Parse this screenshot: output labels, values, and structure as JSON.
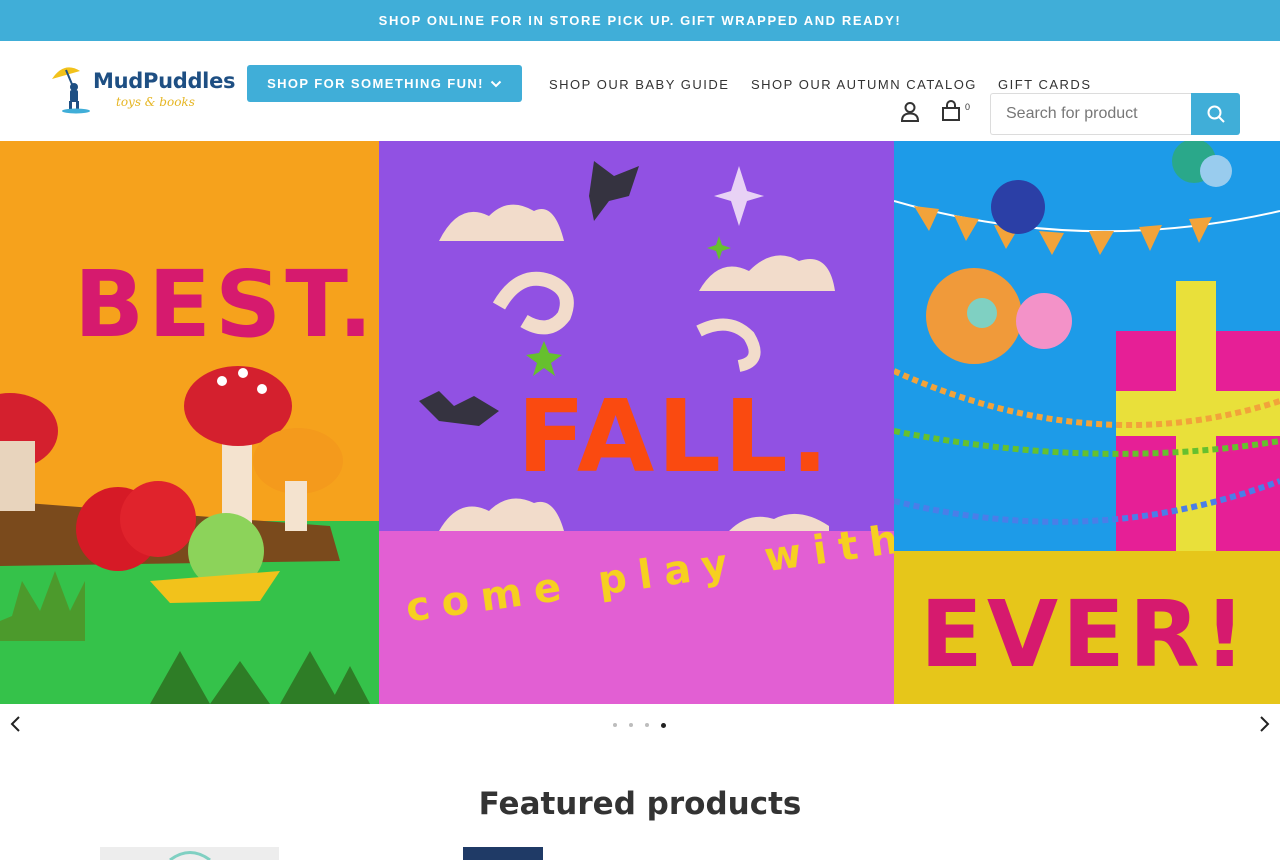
{
  "announcement": {
    "text": "SHOP ONLINE FOR IN STORE PICK UP. GIFT WRAPPED AND READY!",
    "bg_color": "#40aed8"
  },
  "header": {
    "logo": {
      "name": "MudPuddles",
      "tagline": "toys & books"
    },
    "shop_button": {
      "label": "SHOP FOR SOMETHING FUN!",
      "icon": "chevron-down-icon"
    },
    "nav_links": [
      "SHOP OUR BABY GUIDE",
      "SHOP OUR AUTUMN CATALOG",
      "GIFT CARDS"
    ],
    "account_icon": "user-icon",
    "cart": {
      "icon": "bag-icon",
      "count": "0"
    },
    "search": {
      "placeholder": "Search for product",
      "button_icon": "search-icon"
    }
  },
  "hero": {
    "panels": [
      {
        "word": "BEST.",
        "word_color": "#d61a6e",
        "bg": "#f6a21c"
      },
      {
        "word": "FALL.",
        "word_color": "#fa4a10",
        "bg": "#9151e3",
        "tagline": "come play with us!",
        "tagline_color": "#f6d020"
      },
      {
        "word": "EVER!",
        "word_color": "#d61a6e",
        "bg": "#1d9be8"
      }
    ],
    "slides_total": 4,
    "active_slide": 4,
    "prev_icon": "chevron-left-icon",
    "next_icon": "chevron-right-icon"
  },
  "featured": {
    "title": "Featured products"
  },
  "colors": {
    "accent": "#40aed8",
    "brand_navy": "#1e4f83",
    "brand_yellow": "#e6b624"
  }
}
